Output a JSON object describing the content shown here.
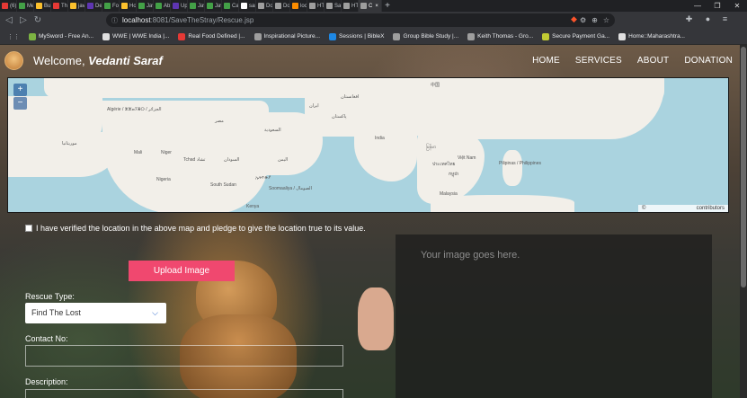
{
  "browser": {
    "tabs": [
      {
        "label": "(6) T",
        "color": "#e53935"
      },
      {
        "label": "Mem",
        "color": "#43a047"
      },
      {
        "label": "Butt",
        "color": "#fbc02d"
      },
      {
        "label": "The",
        "color": "#e53935"
      },
      {
        "label": "javas",
        "color": "#fbc02d"
      },
      {
        "label": "Dem",
        "color": "#5e35b1"
      },
      {
        "label": "For",
        "color": "#43a047"
      },
      {
        "label": "How",
        "color": "#fbc02d"
      },
      {
        "label": "Java",
        "color": "#43a047"
      },
      {
        "label": "Abst",
        "color": "#43a047"
      },
      {
        "label": "Upc",
        "color": "#5e35b1"
      },
      {
        "label": "Java",
        "color": "#43a047"
      },
      {
        "label": "Java",
        "color": "#43a047"
      },
      {
        "label": "Can",
        "color": "#43a047"
      },
      {
        "label": "sam",
        "color": "#ffffff"
      },
      {
        "label": "Don",
        "color": "#9e9e9e"
      },
      {
        "label": "Doc",
        "color": "#9e9e9e"
      },
      {
        "label": "local",
        "color": "#fb8c00"
      },
      {
        "label": "HTT",
        "color": "#9e9e9e"
      },
      {
        "label": "Save",
        "color": "#9e9e9e"
      },
      {
        "label": "HTT",
        "color": "#9e9e9e"
      }
    ],
    "active_tab": {
      "label": "C",
      "close": "×"
    },
    "new_tab": "+",
    "window_controls": {
      "minimize": "—",
      "maximize": "❐",
      "close": "✕"
    },
    "nav": {
      "back": "◁",
      "forward": "▷",
      "reload": "↻",
      "bookmark": "🔖"
    },
    "url": {
      "host": "localhost",
      "path": ":8081/SaveTheStray/Rescue.jsp"
    },
    "omni_icons": [
      "⚙",
      "⊕",
      "☆"
    ],
    "bookmarks": [
      {
        "label": "MySword - Free An...",
        "color": "#7cb342"
      },
      {
        "label": "WWE | WWE India |...",
        "color": "#e0e0e0"
      },
      {
        "label": "Real Food Defined |...",
        "color": "#e53935"
      },
      {
        "label": "Inspirational Picture...",
        "color": "#9e9e9e"
      },
      {
        "label": "Sessions | BibleX",
        "color": "#1e88e5"
      },
      {
        "label": "Group Bible Study |...",
        "color": "#9e9e9e"
      },
      {
        "label": "Keith Thomas - Gro...",
        "color": "#9e9e9e"
      },
      {
        "label": "Secure Payment Ga...",
        "color": "#c0ca33"
      },
      {
        "label": "Home::Maharashtra...",
        "color": "#e0e0e0"
      }
    ]
  },
  "header": {
    "welcome_prefix": "Welcome, ",
    "user_name": "Vedanti Saraf",
    "nav": [
      "HOME",
      "SERVICES",
      "ABOUT",
      "DONATION"
    ]
  },
  "map": {
    "zoom_in": "+",
    "zoom_out": "−",
    "attribution_symbol": "©",
    "attribution_text": "contributors",
    "labels": {
      "algeria": "Algérie / ⵣⵣⴰⵢⴻⵔ / الجزائر",
      "mauritania": "موريتانيا",
      "mali": "Mali",
      "niger": "Niger",
      "chad": "Tchad تشاد",
      "nigeria": "Nigeria",
      "sudan": "السودان",
      "south_sudan": "South Sudan",
      "ethiopia": "ኢትዮጵያ",
      "somalia": "Soomaaliya / الصومال",
      "kenya": "Kenya",
      "egypt": "مصر",
      "saudi": "السعودية",
      "yemen": "اليمن",
      "iran": "ایران",
      "afghanistan": "افغانستان",
      "pakistan": "پاکستان",
      "india": "India",
      "china": "中国",
      "myanmar": "မြန်မာ",
      "thailand": "ประเทศไทย",
      "vietnam": "Việt Nam",
      "cambodia": "កម្ពុជា",
      "philippines": "Pilipinas / Philippines",
      "malaysia": "Malaysia"
    }
  },
  "form": {
    "verify_text": "I have verified the location in the above map and pledge to give the location true to its value.",
    "upload_label": "Upload Image",
    "rescue_type_label": "Rescue Type:",
    "rescue_type_value": "Find The Lost",
    "contact_label": "Contact No:",
    "description_label": "Description:",
    "preview_placeholder": "Your image goes here."
  },
  "colors": {
    "accent": "#f0486f",
    "map_water": "#aad3df",
    "map_land": "#f2efe9",
    "select_chevron": "#1f5fc9"
  }
}
